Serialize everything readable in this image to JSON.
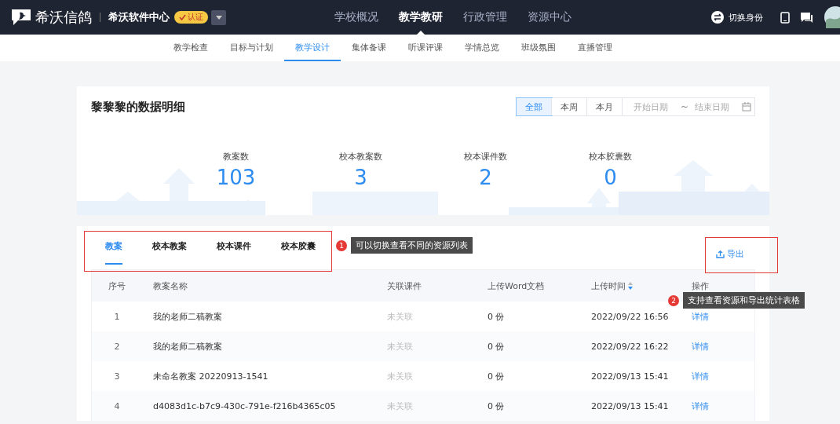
{
  "brand": {
    "name": "希沃信鸽",
    "org": "希沃软件中心",
    "badge": "认证"
  },
  "top_nav": [
    {
      "label": "学校概况",
      "selected": false
    },
    {
      "label": "教学教研",
      "selected": true
    },
    {
      "label": "行政管理",
      "selected": false
    },
    {
      "label": "资源中心",
      "selected": false
    }
  ],
  "identity": {
    "label": "切换身份"
  },
  "sub_nav": [
    {
      "label": "教学检查",
      "selected": false
    },
    {
      "label": "目标与计划",
      "selected": false
    },
    {
      "label": "教学设计",
      "selected": true
    },
    {
      "label": "集体备课",
      "selected": false
    },
    {
      "label": "听课评课",
      "selected": false
    },
    {
      "label": "学情总览",
      "selected": false
    },
    {
      "label": "班级氛围",
      "selected": false
    },
    {
      "label": "直播管理",
      "selected": false
    }
  ],
  "panel": {
    "title": "黎黎黎的数据明细",
    "range_buttons": [
      {
        "label": "全部",
        "selected": true
      },
      {
        "label": "本周",
        "selected": false
      },
      {
        "label": "本月",
        "selected": false
      }
    ],
    "date_start": {
      "placeholder": "开始日期"
    },
    "separator": "~",
    "date_end": {
      "placeholder": "结束日期"
    }
  },
  "stats": [
    {
      "label": "教案数",
      "value": "103"
    },
    {
      "label": "校本教案数",
      "value": "3"
    },
    {
      "label": "校本课件数",
      "value": "2"
    },
    {
      "label": "校本胶囊数",
      "value": "0"
    }
  ],
  "resource_tabs": [
    {
      "label": "教案",
      "selected": true
    },
    {
      "label": "校本教案",
      "selected": false
    },
    {
      "label": "校本课件",
      "selected": false
    },
    {
      "label": "校本胶囊",
      "selected": false
    }
  ],
  "export": "导出",
  "table": {
    "columns": [
      {
        "label": "序号",
        "sortable": false
      },
      {
        "label": "教案名称",
        "sortable": false
      },
      {
        "label": "关联课件",
        "sortable": false
      },
      {
        "label": "上传Word文档",
        "sortable": false
      },
      {
        "label": "上传时间",
        "sortable": true
      },
      {
        "label": "操作",
        "sortable": false
      }
    ],
    "rows": [
      [
        "1",
        "我的老师二稿教案",
        "未关联",
        "0 份",
        "2022/09/22 16:56",
        "详情"
      ],
      [
        "2",
        "我的老师二稿教案",
        "未关联",
        "0 份",
        "2022/09/22 16:22",
        "详情"
      ],
      [
        "3",
        "未命名教案 20220913-1541",
        "未关联",
        "0 份",
        "2022/09/13 15:41",
        "详情"
      ],
      [
        "4",
        "d4083d1c-b7c9-430c-791e-f216b4365c05",
        "未关联",
        "0 份",
        "2022/09/13 15:41",
        "详情"
      ]
    ]
  },
  "annotations": [
    {
      "number": "1",
      "text": "可以切换查看不同的资源列表"
    },
    {
      "number": "2",
      "text": "支持查看资源和导出统计表格"
    }
  ]
}
